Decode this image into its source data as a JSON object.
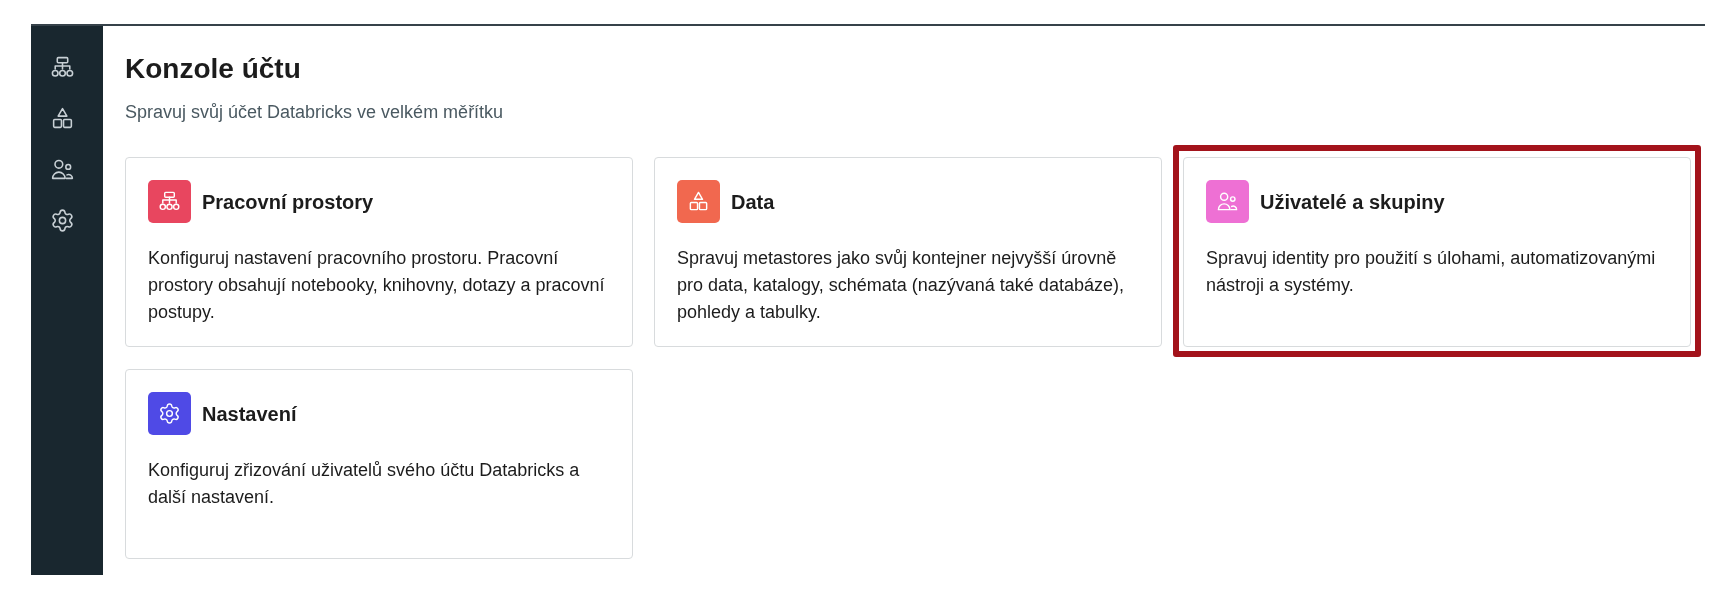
{
  "page": {
    "title": "Konzole účtu",
    "subtitle": "Spravuj svůj účet Databricks ve velkém měřítku"
  },
  "cards": [
    {
      "kind": "workspace",
      "color": "#e8465f",
      "title": "Pracovní prostory",
      "description": "Konfiguruj nastavení pracovního prostoru. Pracovní prostory obsahují notebooky, knihovny, dotazy a pracovní postupy.",
      "highlighted": false
    },
    {
      "kind": "data",
      "color": "#f1684f",
      "title": "Data",
      "description": "Spravuj metastores jako svůj kontejner nejvyšší úrovně pro data, katalogy, schémata (nazývaná také databáze), pohledy a tabulky.",
      "highlighted": false
    },
    {
      "kind": "users",
      "color": "#ee70d4",
      "title": "Uživatelé a skupiny",
      "description": "Spravuj identity pro použití s úlohami, automatizovanými nástroji a systémy.",
      "highlighted": true
    },
    {
      "kind": "settings",
      "color": "#4f4ae6",
      "title": "Nastavení",
      "description": "Konfiguruj zřizování uživatelů svého účtu Databricks a další nastavení.",
      "highlighted": false
    }
  ]
}
